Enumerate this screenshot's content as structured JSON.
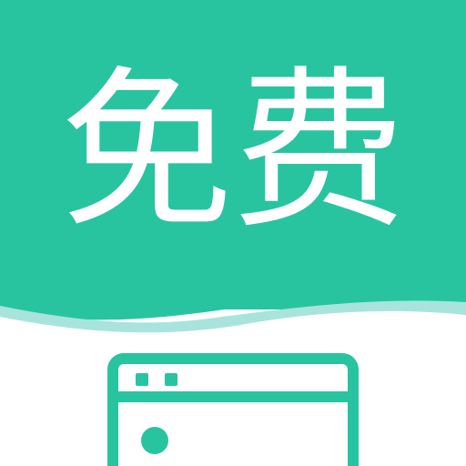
{
  "app_icon": {
    "title": "免费",
    "icon_name": "browser-window-icon"
  },
  "colors": {
    "primary": "#28c4a0",
    "wave_light": "#a8e4dc",
    "background": "#ffffff",
    "title": "#ffffff"
  }
}
